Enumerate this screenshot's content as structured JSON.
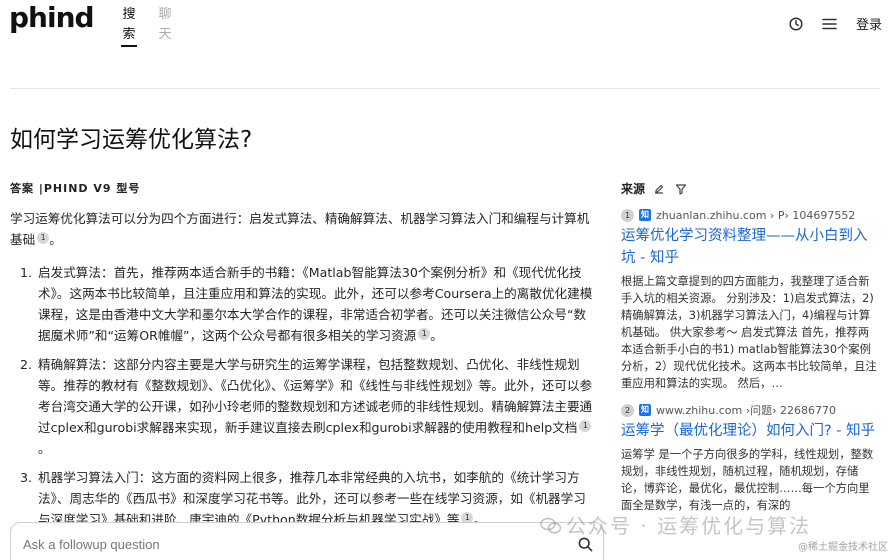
{
  "header": {
    "logo": "phind",
    "nav": [
      {
        "top": "搜",
        "bottom": "索"
      },
      {
        "top": "聊",
        "bottom": "天"
      }
    ],
    "login": "登录",
    "icons": [
      "clock-icon",
      "menu-icon"
    ]
  },
  "page_title": "如何学习运筹优化算法?",
  "answer": {
    "heading": "答案 |PHIND V9 型号",
    "intro": "学习运筹优化算法可以分为四个方面进行：启发式算法、精确解算法、机器学习算法入门和编程与计算机基础",
    "intro_cite": "1",
    "tail": "。",
    "items": [
      {
        "text": "启发式算法：首先，推荐两本适合新手的书籍：《Matlab智能算法30个案例分析》和《现代优化技术》。这两本书比较简单，且注重应用和算法的实现。此外，还可以参考Coursera上的离散优化建模课程，这是由香港中文大学和墨尔本大学合作的课程，非常适合初学者。还可以关注微信公众号“数据魔术师”和“运筹OR帷幄”，这两个公众号都有很多相关的学习资源",
        "cite": "1",
        "tail": "。"
      },
      {
        "text": "精确解算法：这部分内容主要是大学与研究生的运筹学课程，包括整数规划、凸优化、非线性规划等。推荐的教材有《整数规划》、《凸优化》、《运筹学》和《线性与非线性规划》等。此外，还可以参考台湾交通大学的公开课，如孙小玲老师的整数规划和方述诚老师的非线性规划。精确解算法主要通过cplex和gurobi求解器来实现，新手建议直接去刷cplex和gurobi求解器的使用教程和help文档",
        "cite": "1",
        "tail": "。"
      },
      {
        "text": "机器学习算法入门：这方面的资料网上很多，推荐几本非常经典的入坑书，如李航的《统计学习方法》、周志华的《西瓜书》和深度学习花书等。此外，还可以参考一些在线学习资源，如《机器学习与深度学习》基础和进阶、唐宇迪的《Python数据分析与机器学习实战》等",
        "cite": "1",
        "tail": "。"
      }
    ]
  },
  "followup": {
    "placeholder": "Ask a followup question"
  },
  "sources": {
    "heading": "来源",
    "items": [
      {
        "num": "1",
        "favicon": "知",
        "url": "zhuanlan.zhihu.com › P› 104697552",
        "title": "运筹优化学习资料整理——从小白到入坑 - 知乎",
        "snippet": "根据上篇文章提到的四方面能力，我整理了适合新手入坑的相关资源。 分别涉及：1)启发式算法，2)精确解算法，3)机器学习算法入门，4)编程与计算机基础。 供大家参考～ 启发式算法 首先，推荐两本适合新手小白的书1) matlab智能算法30个案例分析，2）现代优化技术。这两本书比较简单，且注重应用和算法的实现。 然后，…"
      },
      {
        "num": "2",
        "favicon": "知",
        "url": "www.zhihu.com ›问题› 22686770",
        "title": "运筹学（最优化理论）如何入门? - 知乎",
        "snippet": "运筹学 是一个子方向很多的学科，线性规划，整数规划，非线性规划，随机过程，随机规划，存储论，博弈论，最优化，最优控制……每一个方向里面全是数学，有浅一点的，有深的"
      }
    ]
  },
  "watermark": {
    "main": "公众号 · 运筹优化与算法",
    "small": "@稀土掘金技术社区"
  }
}
